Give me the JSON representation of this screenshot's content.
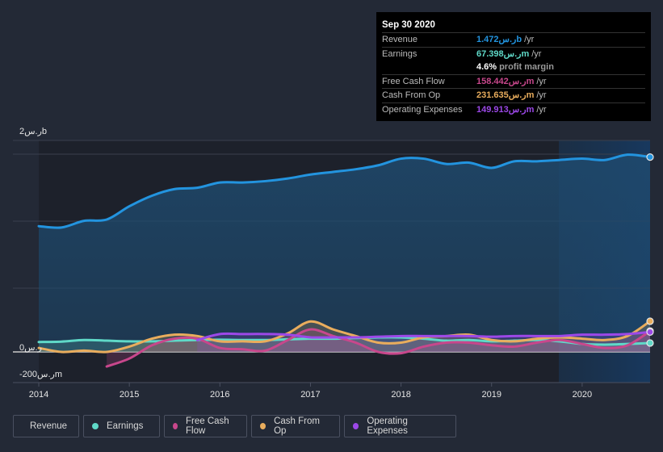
{
  "tooltip": {
    "date": "Sep 30 2020",
    "rows": [
      {
        "label": "Revenue",
        "value": "1.472ر.سb",
        "unit": "/yr",
        "color": "#2394df"
      },
      {
        "label": "Earnings",
        "value": "67.398ر.سm",
        "unit": "/yr",
        "color": "#5fd9c8"
      },
      {
        "label": "",
        "value": "4.6%",
        "unit": "profit margin",
        "color": "#ffffff"
      },
      {
        "label": "Free Cash Flow",
        "value": "158.442ر.سm",
        "unit": "/yr",
        "color": "#c8478c"
      },
      {
        "label": "Cash From Op",
        "value": "231.635ر.سm",
        "unit": "/yr",
        "color": "#e9ad5d"
      },
      {
        "label": "Operating Expenses",
        "value": "149.913ر.سm",
        "unit": "/yr",
        "color": "#9c48e8"
      }
    ]
  },
  "legend": [
    {
      "label": "Revenue",
      "color": "#2394df"
    },
    {
      "label": "Earnings",
      "color": "#5fd9c8"
    },
    {
      "label": "Free Cash Flow",
      "color": "#c8478c"
    },
    {
      "label": "Cash From Op",
      "color": "#e9ad5d"
    },
    {
      "label": "Operating Expenses",
      "color": "#9c48e8"
    }
  ],
  "chart_data": {
    "type": "area",
    "title": "",
    "xlabel": "",
    "ylabel": "",
    "y_unit": "SAR",
    "ytick_labels": [
      "2ر.سb",
      "0ر.س",
      "-200ر.سm"
    ],
    "xtick_labels": [
      "2014",
      "2015",
      "2016",
      "2017",
      "2018",
      "2019",
      "2020"
    ],
    "x_range": [
      2014.0,
      2020.75
    ],
    "highlight_range": [
      2019.75,
      2020.75
    ],
    "grid": true,
    "legend_position": "bottom-left",
    "x": [
      2014.0,
      2014.25,
      2014.5,
      2014.75,
      2015.0,
      2015.25,
      2015.5,
      2015.75,
      2016.0,
      2016.25,
      2016.5,
      2016.75,
      2017.0,
      2017.25,
      2017.5,
      2017.75,
      2018.0,
      2018.25,
      2018.5,
      2018.75,
      2019.0,
      2019.25,
      2019.5,
      2019.75,
      2020.0,
      2020.25,
      2020.5,
      2020.75
    ],
    "series": [
      {
        "name": "Revenue",
        "color": "#2394df",
        "unit": "b",
        "values": [
          0.95,
          0.94,
          0.99,
          1.0,
          1.1,
          1.18,
          1.23,
          1.24,
          1.28,
          1.28,
          1.29,
          1.31,
          1.34,
          1.36,
          1.38,
          1.41,
          1.46,
          1.46,
          1.42,
          1.43,
          1.39,
          1.44,
          1.44,
          1.45,
          1.46,
          1.45,
          1.49,
          1.472
        ]
      },
      {
        "name": "Earnings",
        "color": "#5fd9c8",
        "unit": "b",
        "values": [
          0.075,
          0.078,
          0.09,
          0.085,
          0.08,
          0.08,
          0.085,
          0.09,
          0.092,
          0.09,
          0.09,
          0.095,
          0.1,
          0.1,
          0.105,
          0.11,
          0.11,
          0.1,
          0.085,
          0.09,
          0.08,
          0.085,
          0.09,
          0.08,
          0.06,
          0.055,
          0.06,
          0.0674
        ]
      },
      {
        "name": "Free Cash Flow",
        "color": "#c8478c",
        "unit": "b",
        "values": [
          null,
          null,
          null,
          -0.11,
          -0.05,
          0.05,
          0.1,
          0.1,
          0.03,
          0.02,
          0.01,
          0.09,
          0.17,
          0.12,
          0.07,
          0.0,
          -0.01,
          0.04,
          0.07,
          0.07,
          0.05,
          0.04,
          0.07,
          0.09,
          0.06,
          0.03,
          0.05,
          0.158
        ]
      },
      {
        "name": "Cash From Op",
        "color": "#e9ad5d",
        "unit": "b",
        "values": [
          0.03,
          0.0,
          0.01,
          0.0,
          0.04,
          0.1,
          0.13,
          0.12,
          0.08,
          0.08,
          0.08,
          0.14,
          0.23,
          0.17,
          0.12,
          0.07,
          0.07,
          0.11,
          0.12,
          0.13,
          0.09,
          0.08,
          0.1,
          0.11,
          0.1,
          0.09,
          0.12,
          0.232
        ]
      },
      {
        "name": "Operating Expenses",
        "color": "#9c48e8",
        "unit": "b",
        "values": [
          null,
          null,
          null,
          null,
          null,
          null,
          null,
          0.09,
          0.135,
          0.135,
          0.135,
          0.13,
          0.11,
          0.11,
          0.11,
          0.115,
          0.12,
          0.12,
          0.12,
          0.12,
          0.115,
          0.12,
          0.12,
          0.12,
          0.13,
          0.13,
          0.135,
          0.15
        ]
      }
    ]
  }
}
